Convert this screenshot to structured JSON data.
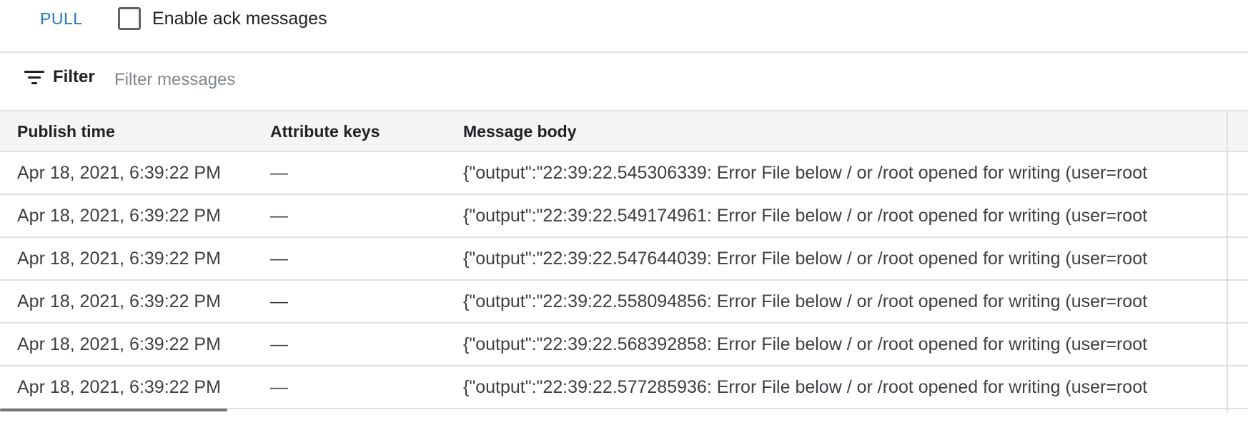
{
  "toolbar": {
    "pull_label": "PULL",
    "ack_label": "Enable ack messages",
    "ack_checked": false
  },
  "filter": {
    "label": "Filter",
    "placeholder": "Filter messages",
    "icon": "filter-list-icon"
  },
  "table": {
    "columns": [
      "Publish time",
      "Attribute keys",
      "Message body"
    ],
    "rows": [
      {
        "publish_time": "Apr 18, 2021, 6:39:22 PM",
        "attribute_keys": "—",
        "message_body": "{\"output\":\"22:39:22.545306339: Error File below / or /root opened for writing (user=root"
      },
      {
        "publish_time": "Apr 18, 2021, 6:39:22 PM",
        "attribute_keys": "—",
        "message_body": "{\"output\":\"22:39:22.549174961: Error File below / or /root opened for writing (user=root"
      },
      {
        "publish_time": "Apr 18, 2021, 6:39:22 PM",
        "attribute_keys": "—",
        "message_body": "{\"output\":\"22:39:22.547644039: Error File below / or /root opened for writing (user=root"
      },
      {
        "publish_time": "Apr 18, 2021, 6:39:22 PM",
        "attribute_keys": "—",
        "message_body": "{\"output\":\"22:39:22.558094856: Error File below / or /root opened for writing (user=root"
      },
      {
        "publish_time": "Apr 18, 2021, 6:39:22 PM",
        "attribute_keys": "—",
        "message_body": "{\"output\":\"22:39:22.568392858: Error File below / or /root opened for writing (user=root"
      },
      {
        "publish_time": "Apr 18, 2021, 6:39:22 PM",
        "attribute_keys": "—",
        "message_body": "{\"output\":\"22:39:22.577285936: Error File below / or /root opened for writing (user=root"
      }
    ]
  },
  "colors": {
    "accent": "#1a73e8",
    "header_bg": "#f5f5f5",
    "divider": "#e0e0e0",
    "cell_text": "#3c4043"
  }
}
